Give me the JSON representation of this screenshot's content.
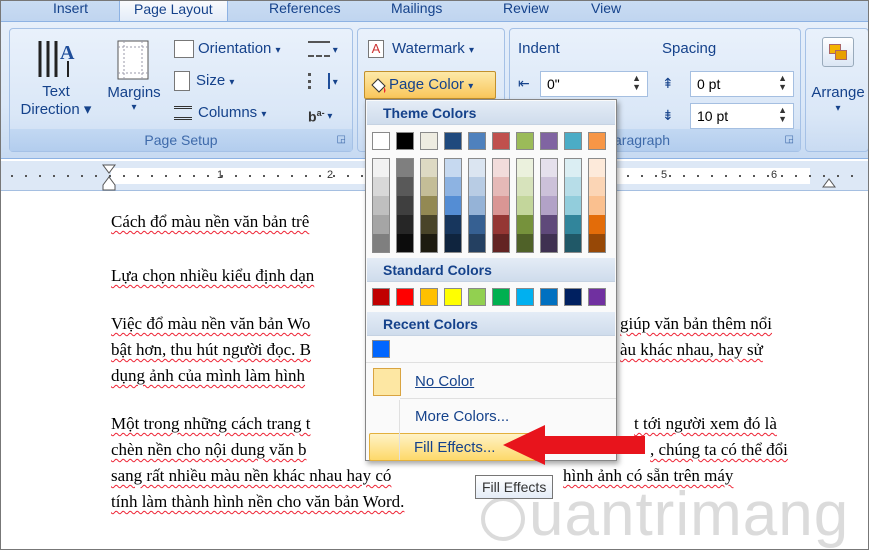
{
  "tabs": [
    "Insert",
    "Page Layout",
    "References",
    "Mailings",
    "Review",
    "View"
  ],
  "page_setup": {
    "text_direction_line1": "Text",
    "text_direction_line2": "Direction",
    "margins": "Margins",
    "orientation": "Orientation",
    "size": "Size",
    "columns": "Columns",
    "group_label": "Page Setup"
  },
  "page_background": {
    "watermark": "Watermark",
    "page_color": "Page Color"
  },
  "paragraph": {
    "indent_label": "Indent",
    "indent_left": "0\"",
    "spacing_label": "Spacing",
    "spacing_before": "0 pt",
    "spacing_after": "10 pt",
    "group_label_visible": "aragraph"
  },
  "arrange": {
    "label": "Arrange"
  },
  "ruler": {
    "numbers": [
      "1",
      "2",
      "5",
      "6"
    ]
  },
  "document": {
    "p1": "Cách đổ màu nền văn bản trê",
    "p2": "Lựa chọn nhiều kiểu định dạn",
    "p3_l1a": "Việc đổ màu nền văn bản Wo",
    "p3_l1b": "giúp văn bản thêm nổi",
    "p3_l2a": "bật hơn, thu hút người đọc. B",
    "p3_l2b": "àu khác nhau, hay sử",
    "p3_l3": "dụng ảnh của mình làm hình",
    "p4_l1a": "Một trong những cách trang t",
    "p4_l1b": "t tới người xem đó là",
    "p4_l2a": "chèn nền cho nội dung văn b",
    "p4_l2b": ", chúng ta có thể đổi",
    "p4_l3a": "sang rất nhiều màu nền khác nhau hay có",
    "p4_l3b": "hình ảnh có sẵn trên máy",
    "p4_l4": "tính làm thành hình nền cho văn bản Word."
  },
  "menu": {
    "theme_colors": "Theme Colors",
    "standard_colors": "Standard Colors",
    "recent_colors": "Recent Colors",
    "no_color": "No Color",
    "more_colors": "More Colors...",
    "fill_effects": "Fill Effects...",
    "tooltip": "Fill Effects"
  },
  "colors": {
    "theme_top": [
      "#ffffff",
      "#000000",
      "#eeece1",
      "#1f497d",
      "#4f81bd",
      "#c0504d",
      "#9bbb59",
      "#8064a2",
      "#4bacc6",
      "#f79646"
    ],
    "theme_shades": [
      [
        "#f2f2f2",
        "#d8d8d8",
        "#bfbfbf",
        "#a5a5a5",
        "#7f7f7f"
      ],
      [
        "#7f7f7f",
        "#595959",
        "#3f3f3f",
        "#262626",
        "#0c0c0c"
      ],
      [
        "#ddd9c3",
        "#c4bd97",
        "#938953",
        "#494429",
        "#1d1b10"
      ],
      [
        "#c6d9f0",
        "#8db3e2",
        "#548dd4",
        "#17365d",
        "#0f243e"
      ],
      [
        "#dbe5f1",
        "#b8cce4",
        "#95b3d7",
        "#366092",
        "#244061"
      ],
      [
        "#f2dcdb",
        "#e5b9b7",
        "#d99694",
        "#953734",
        "#632423"
      ],
      [
        "#ebf1dd",
        "#d7e3bc",
        "#c3d69b",
        "#76923c",
        "#4f6128"
      ],
      [
        "#e5e0ec",
        "#ccc1d9",
        "#b2a2c7",
        "#5f497a",
        "#3f3151"
      ],
      [
        "#dbeef3",
        "#b7dde8",
        "#92cddc",
        "#31859b",
        "#205867"
      ],
      [
        "#fdeada",
        "#fbd5b5",
        "#fac08f",
        "#e36c09",
        "#974806"
      ]
    ],
    "standard": [
      "#c00000",
      "#ff0000",
      "#ffc000",
      "#ffff00",
      "#92d050",
      "#00b050",
      "#00b0f0",
      "#0070c0",
      "#002060",
      "#7030a0"
    ],
    "recent": [
      "#0066ff"
    ],
    "arrow": "#e8141c"
  },
  "watermark_text": "uantrimang"
}
